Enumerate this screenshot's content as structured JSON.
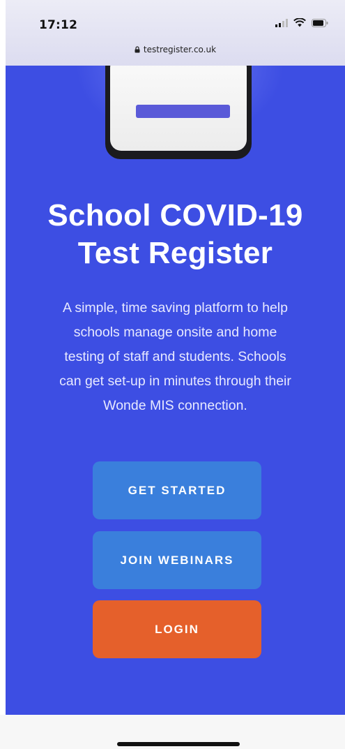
{
  "status_bar": {
    "time": "17:12"
  },
  "browser": {
    "url": "testregister.co.uk"
  },
  "hero": {
    "title_line1": "School COVID-19",
    "title_line2": "Test Register",
    "description_lines": [
      "A simple, time saving platform to help",
      "schools manage onsite and home",
      "testing of staff and students. Schools",
      "can get set-up in minutes through their",
      "Wonde MIS connection."
    ]
  },
  "buttons": {
    "get_started": "GET STARTED",
    "join_webinars": "JOIN WEBINARS",
    "login": "LOGIN"
  },
  "colors": {
    "hero_background": "#3d4ee3",
    "button_blue": "#3a7fdc",
    "button_orange": "#e5602b"
  }
}
